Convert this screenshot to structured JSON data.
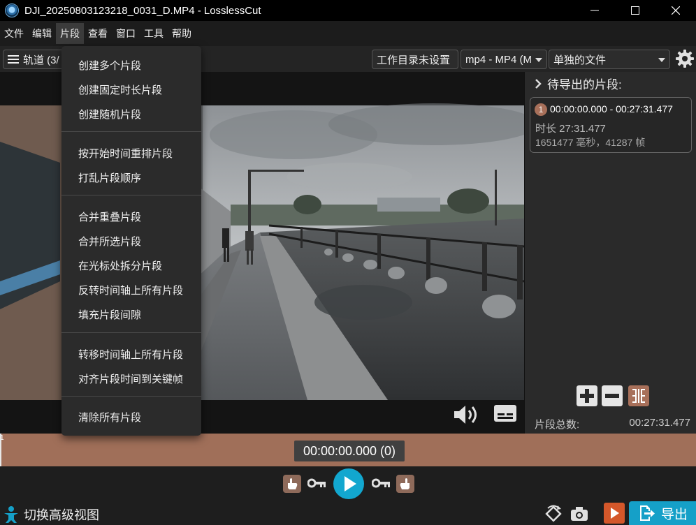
{
  "window": {
    "title": "DJI_20250803123218_0031_D.MP4 - LosslessCut"
  },
  "menubar": {
    "items": [
      {
        "label": "文件"
      },
      {
        "label": "编辑"
      },
      {
        "label": "片段"
      },
      {
        "label": "查看"
      },
      {
        "label": "窗口"
      },
      {
        "label": "工具"
      },
      {
        "label": "帮助"
      }
    ]
  },
  "toolbar": {
    "tracks_label": "轨道 (3/",
    "workdir_label": "工作目录未设置",
    "format_value": "mp4 - MP4 (M",
    "output_mode": "单独的文件"
  },
  "segments_menu": {
    "groups": [
      [
        "创建多个片段",
        "创建固定时长片段",
        "创建随机片段"
      ],
      [
        "按开始时间重排片段",
        "打乱片段顺序"
      ],
      [
        "合并重叠片段",
        "合并所选片段",
        "在光标处拆分片段",
        "反转时间轴上所有片段",
        "填充片段间隙"
      ],
      [
        "转移时间轴上所有片段",
        "对齐片段时间到关键帧"
      ],
      [
        "清除所有片段"
      ]
    ]
  },
  "right_panel": {
    "title": "待导出的片段:",
    "segment": {
      "number": "1",
      "range": "00:00:00.000 - 00:27:31.477",
      "duration": "时长 27:31.477",
      "frames": "1651477 毫秒，41287 帧"
    },
    "total_label": "片段总数:",
    "total_value": "00:27:31.477"
  },
  "timeline": {
    "marker": "1",
    "current_time": "00:00:00.000 (0)"
  },
  "bottom": {
    "advanced_view_label": "切换高级视图",
    "export_label": "导出"
  },
  "colors": {
    "accent": "#12a7cf",
    "timeline": "#a06f59",
    "segment_badge": "#a8705a"
  }
}
